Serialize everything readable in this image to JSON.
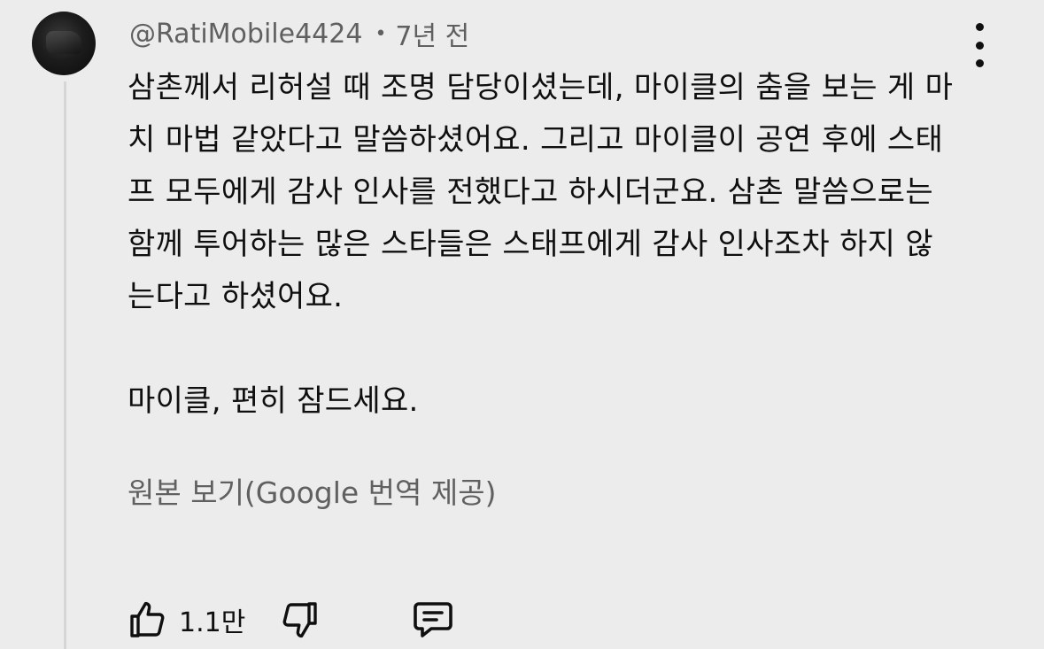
{
  "comment": {
    "author": "@RatiMobile4424",
    "separator": "•",
    "time": "7년 전",
    "text": "삼촌께서 리허설 때 조명 담당이셨는데, 마이클의 춤을 보는 게 마치 마법 같았다고 말씀하셨어요. 그리고 마이클이 공연 후에 스태프 모두에게 감사 인사를 전했다고 하시더군요. 삼촌 말씀으로는 함께 투어하는 많은 스타들은 스태프에게 감사 인사조차 하지 않는다고 하셨어요.\n\n마이클, 편히 잠드세요.",
    "translate_link": "원본 보기(Google 번역 제공)",
    "like_count": "1.1만"
  },
  "icons": {
    "menu": "more-vert-icon",
    "like": "thumb-up-icon",
    "dislike": "thumb-down-icon",
    "reply": "comment-reply-icon"
  },
  "colors": {
    "background": "#ececec",
    "text": "#0f0f0f",
    "secondary_text": "#606060",
    "thread_line": "#d6d6d6"
  }
}
